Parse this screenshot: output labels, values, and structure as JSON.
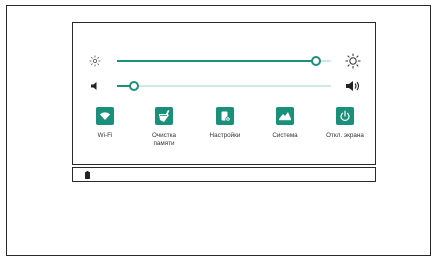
{
  "quick_settings": {
    "brightness": {
      "level": 0.93,
      "low_icon": "brightness-low-icon",
      "high_icon": "brightness-high-icon"
    },
    "volume": {
      "level": 0.08,
      "low_icon": "volume-low-icon",
      "high_icon": "volume-high-icon"
    },
    "accent_color": "#1a8f79",
    "tiles": [
      {
        "label": "Wi-Fi",
        "icon": "wifi-icon"
      },
      {
        "label": "Очистка памяти",
        "icon": "broom-icon"
      },
      {
        "label": "Настройки",
        "icon": "settings-icon"
      },
      {
        "label": "Система",
        "icon": "system-icon"
      },
      {
        "label": "Откл. экрана",
        "icon": "power-icon"
      }
    ]
  },
  "status_bar": {
    "icon": "battery-icon"
  }
}
